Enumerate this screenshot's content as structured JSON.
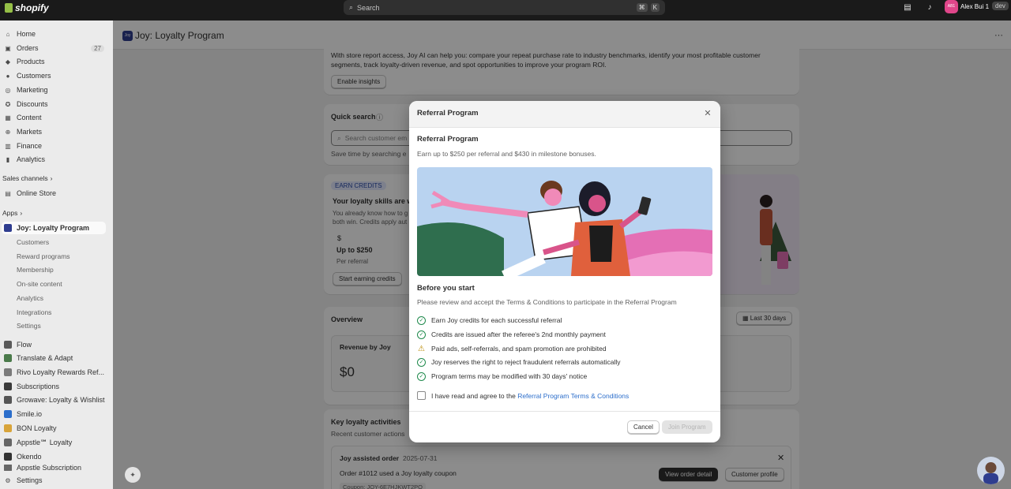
{
  "topbar": {
    "brand": "shopify",
    "search_placeholder": "Search",
    "shortcut_keys": [
      "⌘",
      "K"
    ],
    "user_initials": "AB1",
    "user_name": "Alex Bui 1",
    "store_badge": "dev"
  },
  "sidebar": {
    "main_nav": [
      {
        "label": "Home",
        "icon": "home-icon"
      },
      {
        "label": "Orders",
        "icon": "orders-icon",
        "badge": "27"
      },
      {
        "label": "Products",
        "icon": "tag-icon"
      },
      {
        "label": "Customers",
        "icon": "person-icon"
      },
      {
        "label": "Marketing",
        "icon": "target-icon"
      },
      {
        "label": "Discounts",
        "icon": "discount-icon"
      },
      {
        "label": "Content",
        "icon": "content-icon"
      },
      {
        "label": "Markets",
        "icon": "globe-icon"
      },
      {
        "label": "Finance",
        "icon": "bank-icon"
      },
      {
        "label": "Analytics",
        "icon": "bar-chart-icon"
      }
    ],
    "sales_channels_label": "Sales channels",
    "online_store_label": "Online Store",
    "apps_label": "Apps",
    "active_app": "Joy: Loyalty Program",
    "app_subnav": [
      "Customers",
      "Reward programs",
      "Membership",
      "On-site content",
      "Analytics",
      "Integrations",
      "Settings"
    ],
    "other_apps": [
      "Flow",
      "Translate & Adapt",
      "Rivo Loyalty Rewards Ref...",
      "Subscriptions",
      "Growave: Loyalty & Wishlist",
      "Smile.io",
      "BON Loyalty",
      "Appstle℠ Loyalty",
      "Okendo",
      "Appstle Subscription"
    ],
    "settings_label": "Settings"
  },
  "page": {
    "title": "Joy: Loyalty Program",
    "insights_text": "With store report access, Joy AI can help you: compare your repeat purchase rate to industry benchmarks, identify your most profitable customer segments, track loyalty-driven revenue, and spot opportunities to improve your program ROI.",
    "enable_insights": "Enable insights",
    "quick_search_title": "Quick search",
    "quick_search_placeholder": "Search customer em",
    "quick_search_hint": "Save time by searching e",
    "earn_badge": "EARN CREDITS",
    "earn_title": "Your loyalty skills are wo",
    "earn_desc_1": "You already know how to g",
    "earn_desc_2": "both win. Credits apply aut",
    "earn_amount": "Up to $250",
    "earn_unit": "Per referral",
    "start_earning": "Start earning credits",
    "overview_title": "Overview",
    "date_range": "Last 30 days",
    "revenue_label": "Revenue by Joy",
    "revenue_value": "$0",
    "activities_title": "Key loyalty activities",
    "activities_sub": "Recent customer actions",
    "activity_title": "Joy assisted order",
    "activity_date": "2025-07-31",
    "activity_desc": "Order #1012 used a Joy loyalty coupon",
    "activity_coupon": "Coupon: JOY-6E7HJKWT2PO",
    "view_order": "View order detail",
    "customer_profile": "Customer profile"
  },
  "modal": {
    "header_title": "Referral Program",
    "heading": "Referral Program",
    "subheading": "Earn up to $250 per referral and $430 in milestone bonuses.",
    "before_title": "Before you start",
    "before_desc": "Please review and accept the Terms & Conditions to participate in the Referral Program",
    "rules": [
      {
        "text": "Earn Joy credits for each successful referral",
        "icon": "check-circle-icon"
      },
      {
        "text": "Credits are issued after the referee's 2nd monthly payment",
        "icon": "check-circle-icon"
      },
      {
        "text": "Paid ads, self-referrals, and spam promotion are prohibited",
        "icon": "warning-icon"
      },
      {
        "text": "Joy reserves the right to reject fraudulent referrals automatically",
        "icon": "check-circle-icon"
      },
      {
        "text": "Program terms may be modified with 30 days' notice",
        "icon": "check-circle-icon"
      }
    ],
    "agree_prefix": "I have read and agree to the",
    "agree_link": "Referral Program Terms & Conditions",
    "cancel": "Cancel",
    "join": "Join Program"
  },
  "colors": {
    "accent_link": "#2c6ecb",
    "check_green": "#1f8a4c",
    "warning_amber": "#b98900",
    "illustration_sky": "#b9d3f0",
    "illustration_pink": "#e46fb5",
    "illustration_green": "#2f6e4e"
  }
}
